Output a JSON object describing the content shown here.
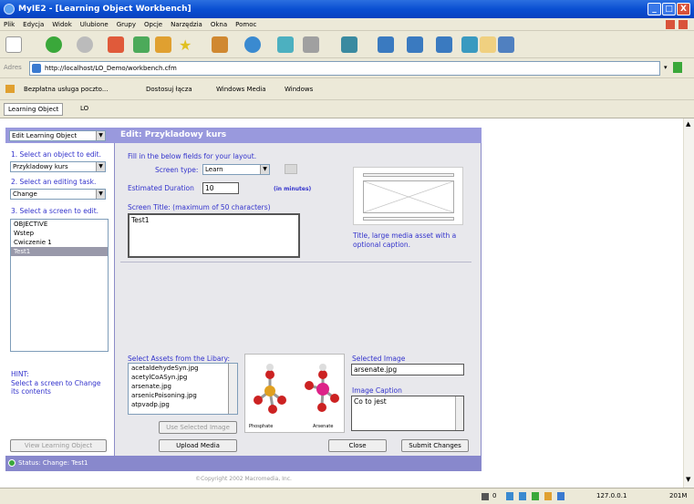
{
  "window": {
    "title": "MyIE2 - [Learning Object Workbench]",
    "min": "_",
    "max": "□",
    "close": "X"
  },
  "menu": [
    "Plik",
    "Edycja",
    "Widok",
    "Ulubione",
    "Grupy",
    "Opcje",
    "Narzędzia",
    "Okna",
    "Pomoc"
  ],
  "address": {
    "label": "Adres",
    "url": "http://localhost/LO_Demo/workbench.cfm"
  },
  "links": [
    "Bezpłatna usługa poczto...",
    "Dostosuj łącza",
    "Windows Media",
    "Windows"
  ],
  "tabs": [
    "Learning Object",
    "LO"
  ],
  "mode_select": "Edit Learning Object",
  "header": "Edit: Przykladowy kurs",
  "left": {
    "step1": "1. Select an object to edit.",
    "object": "Przykladowy kurs",
    "step2": "2. Select an editing task.",
    "task": "Change",
    "step3": "3. Select a screen to edit.",
    "screens": [
      "OBJECTIVE",
      "Wstep",
      "Cwiczenie 1",
      "Test1"
    ],
    "hint_title": "HINT:",
    "hint": "Select a screen to Change its contents",
    "view_button": "View Learning Object"
  },
  "form": {
    "intro": "Fill in the below fields for your layout.",
    "screen_type_label": "Screen type:",
    "screen_type": "Learn",
    "duration_label": "Estimated Duration",
    "duration": "10",
    "duration_unit": "(in minutes)",
    "title_label": "Screen Title: (maximum of 50 characters)",
    "title_value": "Test1",
    "layout_desc": "Title, large media asset with a optional caption."
  },
  "assets": {
    "label": "Select Assets from the Libary:",
    "items": [
      "acetaldehydeSyn.jpg",
      "acetylCoASyn.jpg",
      "arsenate.jpg",
      "arsenicPoisoning.jpg",
      "atpvadp.jpg"
    ],
    "use_button": "Use Selected Image",
    "upload_button": "Upload Media",
    "preview_left": "Phosphate",
    "preview_right": "Arsenate",
    "selected_label": "Selected Image",
    "selected_value": "arsenate.jpg",
    "caption_label": "Image Caption",
    "caption_value": "Co to jest",
    "close_button": "Close",
    "submit_button": "Submit Changes"
  },
  "status": "Status: Change: Test1",
  "footer": "©Copyright 2002 Macromedia, Inc.",
  "statusbar": {
    "count": "0",
    "ip": "127.0.0.1",
    "mem": "201M"
  }
}
